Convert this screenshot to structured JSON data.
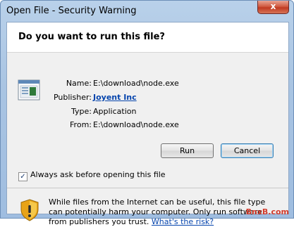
{
  "window": {
    "title": "Open File - Security Warning",
    "close_label": "x"
  },
  "dialog": {
    "heading": "Do you want to run this file?",
    "fields": [
      {
        "label": "Name:",
        "value": "E:\\download\\node.exe"
      },
      {
        "label": "Publisher:",
        "value": "Joyent Inc"
      },
      {
        "label": "Type:",
        "value": "Application"
      },
      {
        "label": "From:",
        "value": "E:\\download\\node.exe"
      }
    ],
    "run_label": "Run",
    "cancel_label": "Cancel",
    "always_ask_label": "Always ask before opening this file",
    "always_ask_checked": true,
    "warning_text": "While files from the Internet can be useful, this file type can potentially harm your computer. Only run software from publishers you trust.",
    "risk_link": "What's the risk?"
  },
  "watermark": "BnxB.com",
  "colors": {
    "link": "#0645ad",
    "close_button": "#c13a22",
    "shield": "#e8a317"
  },
  "icons": {
    "file": "application-file-icon",
    "shield": "warning-shield-icon"
  }
}
